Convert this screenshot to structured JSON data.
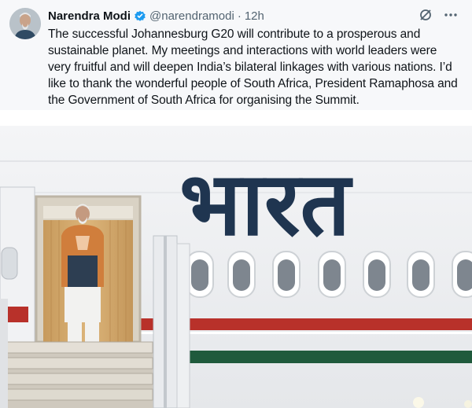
{
  "tweet": {
    "author_name": "Narendra Modi",
    "verified": true,
    "handle": "@narendramodi",
    "separator": "·",
    "time": "12h",
    "text": "The successful Johannesburg G20 will contribute to a prosperous and sustainable planet. My meetings and interactions with world leaders were very fruitful and will deepen India’s bilateral linkages with various nations. I’d like to thank the wonderful people of South Africa, President Ramaphosa and the Government of South Africa for organising the Summit.",
    "action_icons": [
      "slash-circle-icon",
      "more-icon"
    ]
  },
  "photo": {
    "aircraft_lettering": "भारत"
  },
  "colors": {
    "verified_blue": "#1d9bf0",
    "text": "#0f1419",
    "muted": "#536471",
    "livery_navy": "#1f3550",
    "livery_red": "#b8312a",
    "livery_green": "#1f5a3c"
  }
}
